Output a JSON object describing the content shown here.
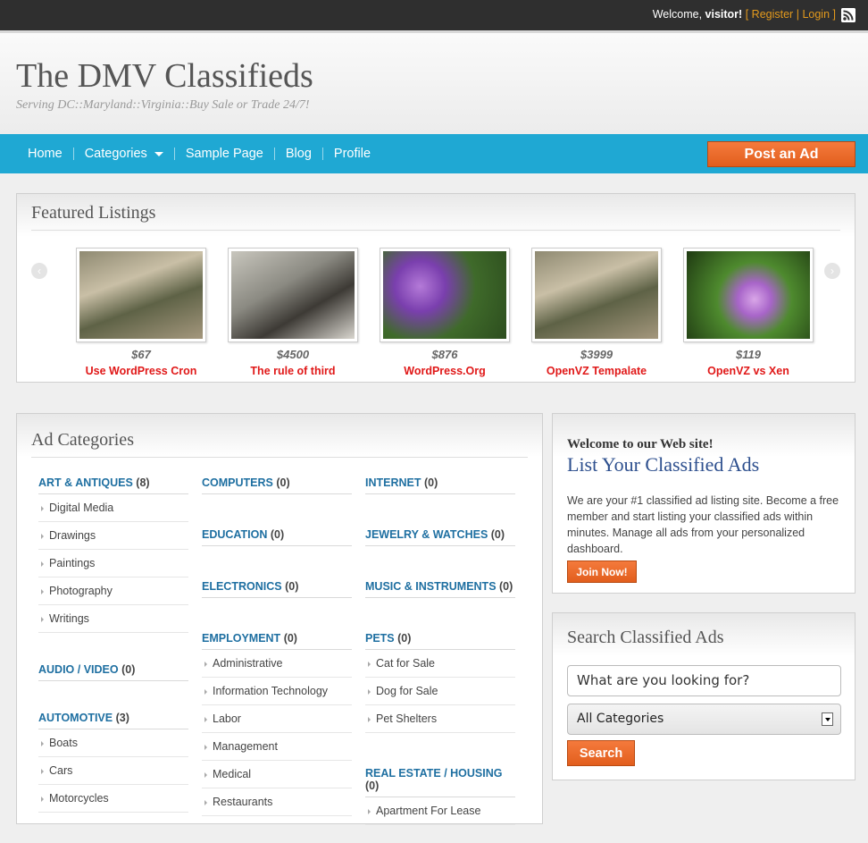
{
  "topbar": {
    "welcome_prefix": "Welcome,",
    "username": "visitor!",
    "open_bracket": "[",
    "register": "Register",
    "separator": "|",
    "login": "Login",
    "close_bracket": "]",
    "rss_icon": "rss-icon"
  },
  "header": {
    "title": "The DMV Classifieds",
    "tagline": "Serving DC::Maryland::Virginia::Buy Sale or Trade 24/7!"
  },
  "nav": {
    "items": [
      "Home",
      "Categories",
      "Sample Page",
      "Blog",
      "Profile"
    ],
    "post_ad": "Post an Ad"
  },
  "featured": {
    "title": "Featured Listings",
    "prev_icon": "chevron-left-icon",
    "next_icon": "chevron-right-icon",
    "items": [
      {
        "price": "$67",
        "title": "Use WordPress Cron"
      },
      {
        "price": "$4500",
        "title": "The rule of third"
      },
      {
        "price": "$876",
        "title": "WordPress.Org"
      },
      {
        "price": "$3999",
        "title": "OpenVZ Tempalate"
      },
      {
        "price": "$119",
        "title": "OpenVZ vs Xen"
      }
    ]
  },
  "ad_categories": {
    "title": "Ad Categories",
    "col1": {
      "art": {
        "name": "ART & ANTIQUES",
        "count": "(8)",
        "subs": [
          "Digital Media",
          "Drawings",
          "Paintings",
          "Photography",
          "Writings"
        ]
      },
      "audio": {
        "name": "AUDIO / VIDEO",
        "count": "(0)"
      },
      "auto": {
        "name": "AUTOMOTIVE",
        "count": "(3)",
        "subs": [
          "Boats",
          "Cars",
          "Motorcycles"
        ]
      }
    },
    "col2": {
      "computers": {
        "name": "COMPUTERS",
        "count": "(0)"
      },
      "education": {
        "name": "EDUCATION",
        "count": "(0)"
      },
      "electronics": {
        "name": "ELECTRONICS",
        "count": "(0)"
      },
      "employment": {
        "name": "EMPLOYMENT",
        "count": "(0)",
        "subs": [
          "Administrative",
          "Information Technology",
          "Labor",
          "Management",
          "Medical",
          "Restaurants"
        ]
      }
    },
    "col3": {
      "internet": {
        "name": "INTERNET",
        "count": "(0)"
      },
      "jewelry": {
        "name": "JEWELRY & WATCHES",
        "count": "(0)"
      },
      "music": {
        "name": "MUSIC & INSTRUMENTS",
        "count": "(0)"
      },
      "pets": {
        "name": "PETS",
        "count": "(0)",
        "subs": [
          "Cat for Sale",
          "Dog for Sale",
          "Pet Shelters"
        ]
      },
      "realestate": {
        "name": "REAL ESTATE / HOUSING",
        "count": "(0)",
        "subs": [
          "Apartment For Lease"
        ]
      }
    }
  },
  "welcome_box": {
    "heading": "Welcome to our Web site!",
    "title": "List Your Classified Ads",
    "text": "We are your #1 classified ad listing site. Become a free member and start listing your classified ads within minutes. Manage all ads from your personalized dashboard.",
    "button": "Join Now!"
  },
  "search_box": {
    "title": "Search Classified Ads",
    "placeholder": "What are you looking for?",
    "category_selected": "All Categories",
    "button": "Search"
  },
  "colors": {
    "nav_bg": "#1fa8d3",
    "accent_orange": "#e8662a",
    "category_link": "#1e6fa1",
    "featured_title": "#e01818"
  }
}
